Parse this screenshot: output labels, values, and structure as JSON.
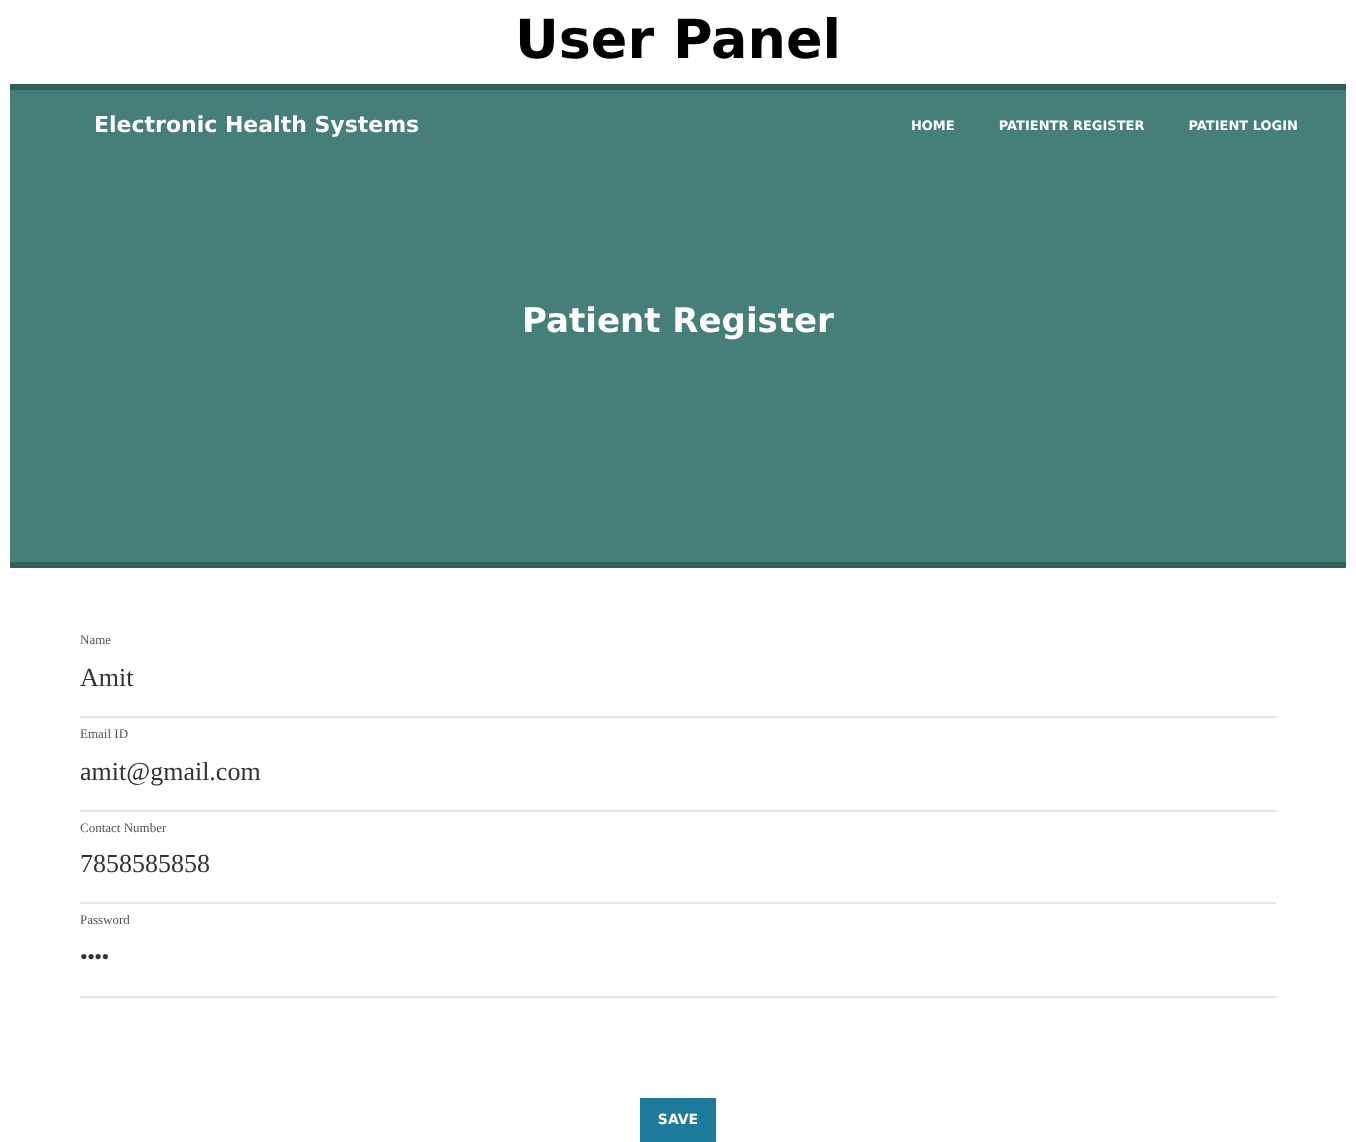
{
  "heading": "User Panel",
  "navbar": {
    "brand": "Electronic Health Systems",
    "links": [
      "HOME",
      "PATIENTR REGISTER",
      "PATIENT LOGIN"
    ]
  },
  "hero": {
    "title": "Patient Register"
  },
  "fields": [
    {
      "label": "Name",
      "value": "Amit",
      "kind": "text"
    },
    {
      "label": "Email ID",
      "value": "amit@gmail.com",
      "kind": "text"
    },
    {
      "label": "Contact Number",
      "value": "7858585858",
      "kind": "text"
    },
    {
      "label": "Password",
      "value": "••••",
      "kind": "password"
    }
  ],
  "save_button": "SAVE"
}
